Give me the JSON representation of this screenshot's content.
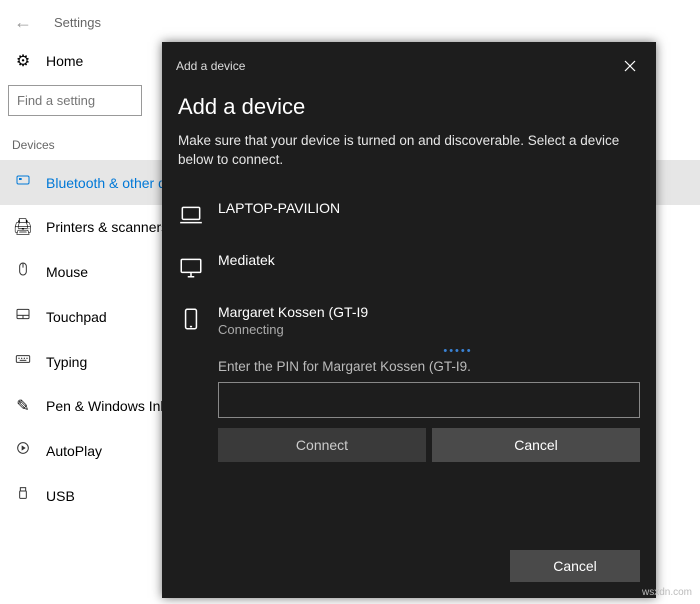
{
  "header": {
    "title": "Settings"
  },
  "home": {
    "label": "Home"
  },
  "search": {
    "placeholder": "Find a setting"
  },
  "section": "Devices",
  "nav": [
    {
      "label": "Bluetooth & other dev"
    },
    {
      "label": "Printers & scanners"
    },
    {
      "label": "Mouse"
    },
    {
      "label": "Touchpad"
    },
    {
      "label": "Typing"
    },
    {
      "label": "Pen & Windows Ink"
    },
    {
      "label": "AutoPlay"
    },
    {
      "label": "USB"
    }
  ],
  "dialog": {
    "titlebar": "Add a device",
    "heading": "Add a device",
    "subtitle": "Make sure that your device is turned on and discoverable. Select a device below to connect.",
    "devices": [
      {
        "name": "LAPTOP-PAVILION"
      },
      {
        "name": "Mediatek"
      },
      {
        "name": "Margaret Kossen (GT-I9",
        "status": "Connecting"
      }
    ],
    "pin_prompt": "Enter the PIN for Margaret Kossen (GT-I9.",
    "connect_label": "Connect",
    "inline_cancel_label": "Cancel",
    "footer_cancel_label": "Cancel"
  },
  "watermark": "wsxdn.com"
}
